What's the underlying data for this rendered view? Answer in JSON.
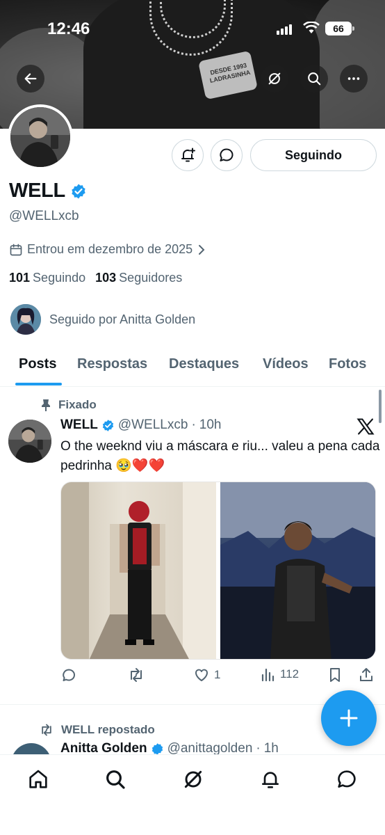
{
  "status_bar": {
    "time": "12:46",
    "battery": "66"
  },
  "profile": {
    "name": "WELL",
    "handle": "@WELLxcb",
    "joined": "Entrou em dezembro de 2025",
    "following_count": "101",
    "following_label": "Seguindo",
    "followers_count": "103",
    "followers_label": "Seguidores",
    "followed_by": "Seguido por Anitta Golden",
    "follow_button": "Seguindo",
    "banner_text": "DESDE 1993 LADRASINHA"
  },
  "tabs": [
    "Posts",
    "Respostas",
    "Destaques",
    "Vídeos",
    "Fotos"
  ],
  "pinned_post": {
    "pinned_label": "Fixado",
    "author": "WELL",
    "handle": "@WELLxcb",
    "time": "10h",
    "text": "O the weeknd viu a máscara e riu... valeu a pena cada pedrinha 🥹❤️❤️",
    "likes": "1",
    "views": "112"
  },
  "second_post": {
    "repost_label": "WELL repostado",
    "author": "Anitta Golden",
    "handle": "@anittagolden",
    "time": "1h"
  },
  "colors": {
    "accent": "#1d9bf0",
    "text": "#0f1419",
    "muted": "#536471"
  }
}
